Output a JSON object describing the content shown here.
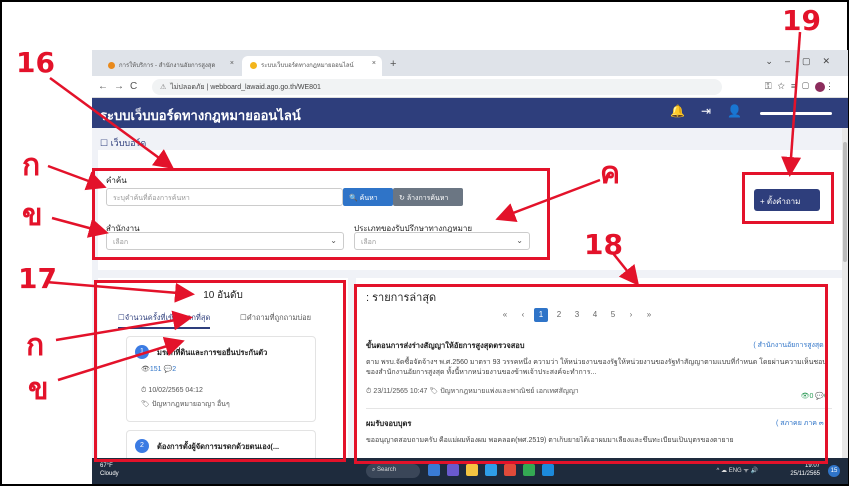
{
  "browser": {
    "tabs": [
      {
        "label": "การให้บริการ - สำนักงานอัยการสูงสุด"
      },
      {
        "label": "ระบบเว็บบอร์ดทางกฎหมายออนไลน์"
      }
    ],
    "url_security": "ไม่ปลอดภัย",
    "url": "webboard_lawaid.ago.go.th/WE801"
  },
  "app": {
    "title": "ระบบเว็บบอร์ดทางกฎหมายออนไลน์",
    "breadcrumb": "เว็บบอร์ด"
  },
  "search": {
    "keyword_label": "คำค้น",
    "keyword_placeholder": "ระบุคำค้นที่ต้องการค้นหา",
    "search_button": "ค้นหา",
    "clear_button": "ล้างการค้นหา",
    "office_label": "สำนักงาน",
    "office_value": "เลือก",
    "service_type_label": "ประเภทของรับปรึกษาทางกฎหมาย",
    "service_type_value": "เลือก",
    "ask_button": "+ ตั้งคำถาม"
  },
  "top10": {
    "title": "10 อันดับ",
    "tab_views": "จำนวนครั้งที่เข้าดูมากที่สุด",
    "tab_frequent": "คำถามที่ถูกถามบ่อย",
    "items": [
      {
        "rank": "1",
        "title": "มรดกที่ดินและการขอยื่นประกันตัว",
        "views": "151",
        "comments": "2",
        "date": "10/02/2565 04:12",
        "tags": "ปัญหากฎหมายอาญา  อื่นๆ"
      },
      {
        "rank": "2",
        "title": "ต้องการตั้งผู้จัดการมรดกด้วยตนเอง(..."
      }
    ]
  },
  "latest": {
    "title": "รายการล่าสุด",
    "pages": [
      "1",
      "2",
      "3",
      "4",
      "5"
    ],
    "posts": [
      {
        "title": "ขั้นตอนการส่งร่างสัญญาให้อัยการสูงสุดตรวจสอบ",
        "office": "( สำนักงานอัยการสูงสุด )",
        "body": "ตาม พรบ.จัดซื้อจัดจ้างฯ พ.ศ.2560 มาตรา 93 วรรคหนึ่ง ความว่า ให้หน่วยงานของรัฐให้หน่วยงานของรัฐทำสัญญาตามแบบที่กำหนด โดยผ่านความเห็นชอบของสำนักงานอัยการสูงสุด ทั้งนี้หากหน่วยงานของข้าพเจ้าประสงค์จะทำการ...",
        "date": "23/11/2565 10:47",
        "tags": "ปัญหากฎหมายแพ่งและพาณิชย์  เอกเทศสัญญา",
        "views": "0",
        "comments": "0"
      },
      {
        "title": "ผมรับจอบบุตร",
        "office": "( สภาคย ภาค ๓ )",
        "body": "ขออนุญาตสอบถามครับ คือแม่ผมท้องผม พอคลอด(พศ.2519) ตาเก็บยายได้เอาผมมาเลี้ยงและขึ้นทะเบียนเป็นบุตรของตายาย"
      }
    ]
  },
  "taskbar": {
    "weather_temp": "67°F",
    "weather_text": "Cloudy",
    "search": "Search",
    "lang": "ENG",
    "time": "19:07",
    "date": "25/11/2565",
    "badge": "15"
  },
  "annotations": {
    "n16": "16",
    "n17": "17",
    "n18": "18",
    "n19": "19",
    "ka1": "ก",
    "kho1": "ข",
    "kho_k": "ค",
    "ka2": "ก",
    "kho2": "ข"
  },
  "colors": {
    "annotation": "#e3122a",
    "header": "#2e3e7c",
    "primary": "#2f74c8"
  }
}
